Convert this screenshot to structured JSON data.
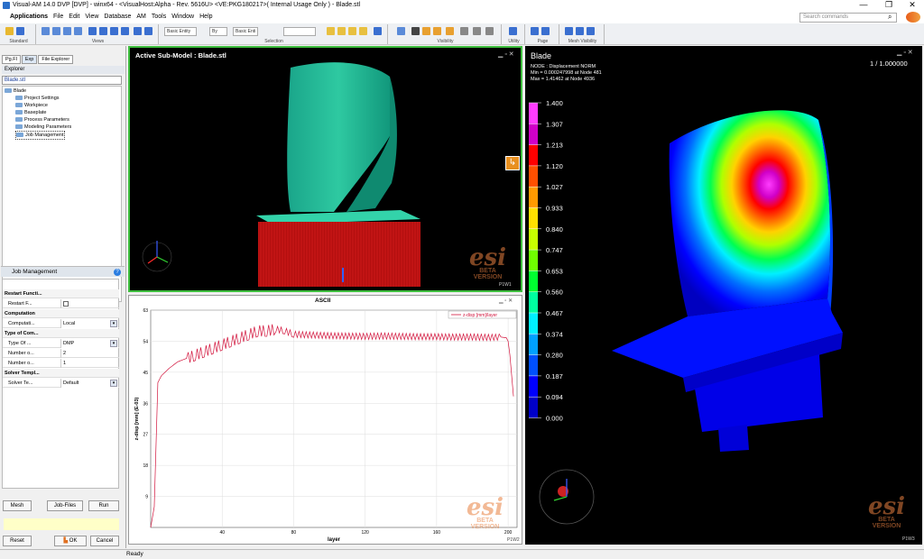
{
  "window": {
    "title": "Visual-AM 14.0 DVP [DVP]  - winx64 - <VisualHost:Alpha - Rev. 5616U> <VE:PKG180217>( Internal Usage Only ) - Blade.stl",
    "minimize": "—",
    "maximize": "❐",
    "close": "✕"
  },
  "menu": [
    "Applications",
    "File",
    "Edit",
    "View",
    "Database",
    "AM",
    "Tools",
    "Window",
    "Help"
  ],
  "search": {
    "placeholder": "Search commands"
  },
  "toolbar": {
    "groups": [
      "Standard",
      "Views",
      "Selection",
      "Visibility",
      "Utility",
      "Page",
      "Mesh Visibility"
    ],
    "entity1": "Basic Entity",
    "entity2": "By",
    "entity3": "Basic Enti"
  },
  "leftpanel": {
    "tabs": [
      "Pg.Fl",
      "Exp",
      "File Explorer"
    ],
    "explorer": "Explorer",
    "combo": "Blade.stl",
    "tree": [
      "Blade",
      "Project Settings",
      "Workpiece",
      "Baseplate",
      "Process Parameters",
      "Modeling Parameters",
      "Job Management"
    ]
  },
  "job": {
    "header": "Job Management",
    "help": "?",
    "rows": [
      {
        "type": "sec",
        "k": "Restart Functi..."
      },
      {
        "type": "chk",
        "k": "Restart F..."
      },
      {
        "type": "sec",
        "k": "Computation"
      },
      {
        "type": "sel",
        "k": "Computati...",
        "v": "Local"
      },
      {
        "type": "sec",
        "k": "Type of Com..."
      },
      {
        "type": "sel",
        "k": "Type Of ...",
        "v": "DMP"
      },
      {
        "type": "val",
        "k": "Number o...",
        "v": "2"
      },
      {
        "type": "val",
        "k": "Number o...",
        "v": "1"
      },
      {
        "type": "sec",
        "k": "Solver Templ..."
      },
      {
        "type": "sel",
        "k": "Solver Te...",
        "v": "Default"
      }
    ],
    "buttons": {
      "mesh": "Mesh",
      "jobfiles": "Job-Files",
      "run": "Run",
      "reset": "Reset",
      "ok": "OK",
      "cancel": "Cancel"
    }
  },
  "status": "Ready",
  "vp1": {
    "title": "Active  Sub-Model  :  Blade.stl",
    "tag": "P1W1"
  },
  "vp2": {
    "title": "ASCII",
    "tag": "P1W2"
  },
  "vp3": {
    "title": "Blade",
    "page": "1  /  1.000000",
    "info1": "NODE : Displacement NORM",
    "info2": "Min  = 0.000247998  at  Node  481",
    "info3": "Max  = 1.41462  at  Node  4936",
    "tag": "P1W3"
  },
  "watermark": {
    "beta": "BETA",
    "version": "VERSION"
  },
  "legend": {
    "values": [
      "1.400",
      "1.307",
      "1.213",
      "1.120",
      "1.027",
      "0.933",
      "0.840",
      "0.747",
      "0.653",
      "0.560",
      "0.467",
      "0.374",
      "0.280",
      "0.187",
      "0.094",
      "0.000"
    ],
    "colors": [
      "#ff3cff",
      "#d000c8",
      "#ff0000",
      "#ff5000",
      "#ff9a00",
      "#ffe000",
      "#c8ff00",
      "#70ff00",
      "#00ff30",
      "#00ffa0",
      "#00f0ff",
      "#00a0ff",
      "#0050ff",
      "#0000ff",
      "#0000c8"
    ]
  },
  "chart_data": {
    "type": "line",
    "title": "ASCII",
    "xlabel": "layer",
    "ylabel": "z-disp [mm] (E-03)",
    "xlim": [
      0,
      205
    ],
    "ylim": [
      0,
      63
    ],
    "xticks": [
      "40",
      "80",
      "120",
      "160",
      "200"
    ],
    "yticks": [
      "9",
      "18",
      "27",
      "36",
      "45",
      "54",
      "63"
    ],
    "series": [
      {
        "name": "z-disp [mm]/layer",
        "color": "#d2143c",
        "x": [
          0,
          2,
          4,
          6,
          10,
          15,
          20,
          25,
          30,
          35,
          40,
          45,
          50,
          55,
          60,
          65,
          70,
          75,
          80,
          90,
          100,
          110,
          120,
          130,
          140,
          150,
          160,
          170,
          180,
          190,
          196,
          199,
          200,
          201,
          202,
          203
        ],
        "y": [
          0,
          6,
          42,
          44,
          46,
          48,
          49,
          50,
          51,
          52,
          53,
          54,
          55,
          56,
          57,
          57,
          57.5,
          57,
          56,
          55.8,
          55.6,
          55.5,
          55.4,
          55.5,
          55.4,
          55.3,
          55.3,
          55.2,
          55.2,
          55.1,
          55.2,
          55,
          54,
          50,
          44,
          38
        ]
      }
    ]
  }
}
